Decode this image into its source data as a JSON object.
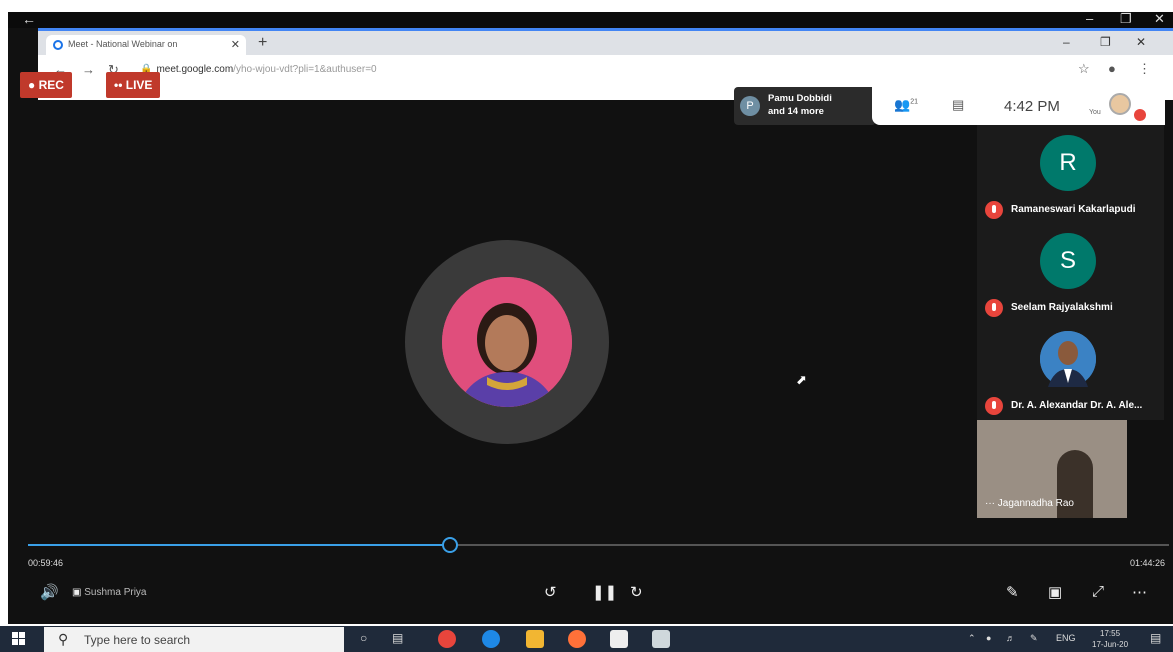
{
  "browser": {
    "tab_title": "Meet - National Webinar on",
    "url_domain": "meet.google.com",
    "url_rest": "/yho-wjou-vdt?pli=1&authuser=0"
  },
  "recording": {
    "rec_label": "REC",
    "live_label": "LIVE"
  },
  "meet": {
    "presenter_initial": "P",
    "presenter_line1": "Pamu Dobbidi",
    "presenter_line2": "and 14 more",
    "participant_count": "21",
    "clock": "4:42 PM",
    "you_label": "You"
  },
  "participants": [
    {
      "initial": "R",
      "name": "Ramaneswari Kakarlapudi",
      "color": "#00796b"
    },
    {
      "initial": "S",
      "name": "Seelam Rajyalakshmi",
      "color": "#00796b"
    },
    {
      "initial": "",
      "name": "Dr. A. Alexandar Dr. A. Ale...",
      "color": "#3b82c4"
    }
  ],
  "video_tile": {
    "name": "Jagannadha Rao"
  },
  "player": {
    "current_time": "00:59:46",
    "total_time": "01:44:26",
    "progress": 0.37,
    "presenter_caption": "Sushma Priya",
    "accent_color": "#3aa0e8"
  },
  "taskbar": {
    "search_placeholder": "Type here to search",
    "lang": "ENG",
    "time": "17:55",
    "date": "17-Jun-20"
  }
}
